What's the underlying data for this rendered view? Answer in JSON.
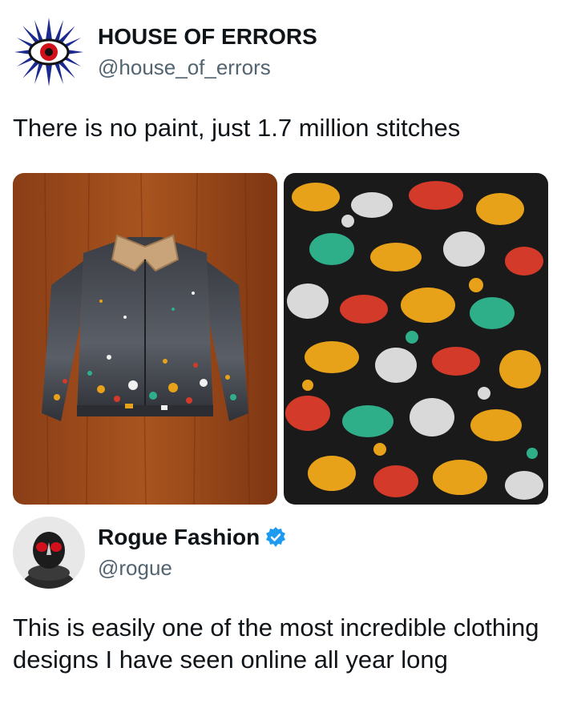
{
  "first_post": {
    "author_name": "HOUSE OF ERRORS",
    "author_handle": "@house_of_errors",
    "text": "There is no paint, just 1.7 million stitches",
    "media": [
      {
        "icon": "jacket-photo"
      },
      {
        "icon": "embroidery-closeup-photo"
      }
    ]
  },
  "second_post": {
    "author_name": "Rogue Fashion",
    "author_handle": "@rogue",
    "verified": true,
    "text": "This is easily one of the most incredible clothing designs I have seen online all year long"
  },
  "colors": {
    "text_primary": "#0f1419",
    "text_secondary": "#536471",
    "verified_blue": "#1d9bf0",
    "avatar_eye_red": "#d0101a",
    "avatar_ray_blue": "#1b2a8f"
  }
}
